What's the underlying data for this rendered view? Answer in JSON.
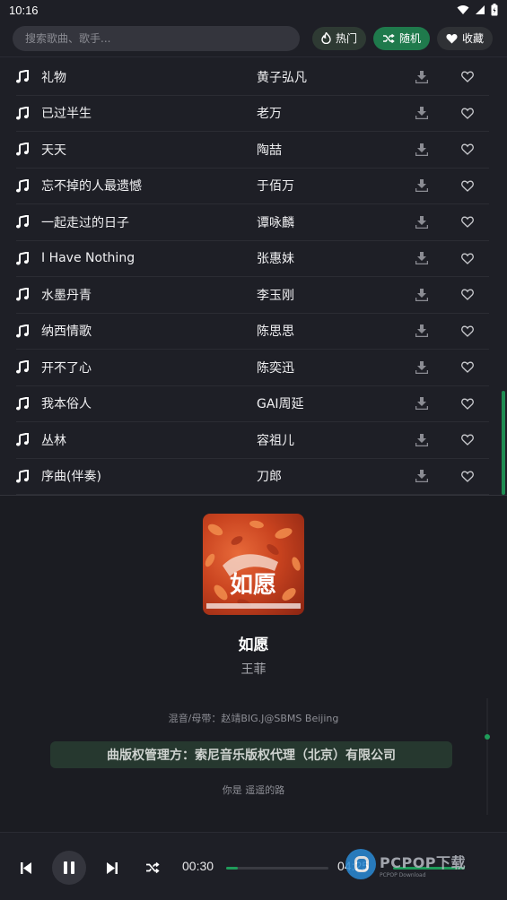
{
  "status": {
    "time": "10:16"
  },
  "search": {
    "placeholder": "搜索歌曲、歌手..."
  },
  "chips": [
    {
      "label": "热门",
      "icon": "fire-icon"
    },
    {
      "label": "随机",
      "icon": "shuffle-icon"
    },
    {
      "label": "收藏",
      "icon": "heart-icon"
    }
  ],
  "songs": [
    {
      "title": "礼物",
      "artist": "黄子弘凡"
    },
    {
      "title": "已过半生",
      "artist": "老万"
    },
    {
      "title": "天天",
      "artist": "陶喆"
    },
    {
      "title": "忘不掉的人最遗憾",
      "artist": "于佰万"
    },
    {
      "title": "一起走过的日子",
      "artist": "谭咏麟"
    },
    {
      "title": "I Have Nothing",
      "artist": "张惠妹"
    },
    {
      "title": "水墨丹青",
      "artist": "李玉刚"
    },
    {
      "title": "纳西情歌",
      "artist": "陈思思"
    },
    {
      "title": "开不了心",
      "artist": "陈奕迅"
    },
    {
      "title": "我本俗人",
      "artist": "GAI周延"
    },
    {
      "title": "丛林",
      "artist": "容祖儿"
    },
    {
      "title": "序曲(伴奏)",
      "artist": "刀郎"
    }
  ],
  "now_playing": {
    "title": "如愿",
    "artist": "王菲",
    "cover_text": "如愿",
    "lyrics": [
      "混音/母带：赵靖BIG.J@SBMS Beijing",
      "曲版权管理方：索尼音乐版权代理（北京）有限公司",
      "你是 遥遥的路"
    ]
  },
  "player": {
    "current_time": "00:30",
    "total_time": "04:25",
    "progress": 0.113
  },
  "watermark": {
    "big": "PCPOP下载",
    "small": "PCPOP Download"
  },
  "colors": {
    "accent": "#1f9c5a",
    "background": "#1e1f26"
  }
}
